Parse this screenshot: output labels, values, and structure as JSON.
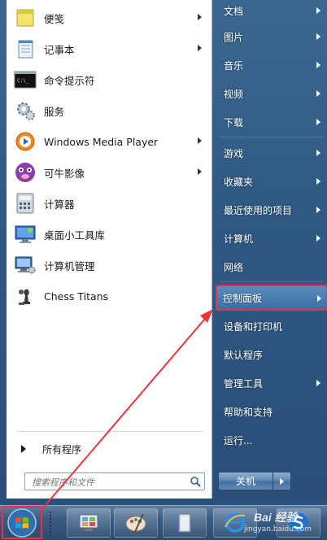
{
  "programs": [
    {
      "label": "便笺",
      "icon": "sticky-notes-icon",
      "has_arrow": true
    },
    {
      "label": "记事本",
      "icon": "notepad-icon",
      "has_arrow": true
    },
    {
      "label": "命令提示符",
      "icon": "command-prompt-icon",
      "has_arrow": false
    },
    {
      "label": "服务",
      "icon": "services-gear-icon",
      "has_arrow": false
    },
    {
      "label": "Windows Media Player",
      "icon": "media-player-icon",
      "has_arrow": true
    },
    {
      "label": "可牛影像",
      "icon": "keniu-image-icon",
      "has_arrow": true
    },
    {
      "label": "计算器",
      "icon": "calculator-icon",
      "has_arrow": false
    },
    {
      "label": "桌面小工具库",
      "icon": "gadgets-icon",
      "has_arrow": false
    },
    {
      "label": "计算机管理",
      "icon": "computer-management-icon",
      "has_arrow": false
    },
    {
      "label": "Chess Titans",
      "icon": "chess-icon",
      "has_arrow": false
    }
  ],
  "all_programs": {
    "label": "所有程序"
  },
  "search": {
    "placeholder": "搜索程序和文件"
  },
  "places": [
    {
      "label": "文档",
      "has_arrow": true
    },
    {
      "label": "图片",
      "has_arrow": true
    },
    {
      "label": "音乐",
      "has_arrow": true
    },
    {
      "label": "视频",
      "has_arrow": true
    },
    {
      "label": "下载",
      "has_arrow": true
    },
    {
      "label": "游戏",
      "has_arrow": true
    },
    {
      "label": "收藏夹",
      "has_arrow": true
    },
    {
      "label": "最近使用的项目",
      "has_arrow": true
    },
    {
      "label": "计算机",
      "has_arrow": true
    },
    {
      "label": "网络",
      "has_arrow": false
    },
    {
      "label": "控制面板",
      "has_arrow": true,
      "highlighted": true
    },
    {
      "label": "设备和打印机",
      "has_arrow": false
    },
    {
      "label": "默认程序",
      "has_arrow": false
    },
    {
      "label": "管理工具",
      "has_arrow": true
    },
    {
      "label": "帮助和支持",
      "has_arrow": false
    },
    {
      "label": "运行...",
      "has_arrow": false
    }
  ],
  "shutdown": {
    "label": "关机"
  },
  "taskbar": {
    "apps": [
      "control-panel-icon",
      "paint-icon",
      "explorer-icon",
      "ie-icon",
      "sogou-icon"
    ]
  },
  "watermark": {
    "text": "Bai 经验",
    "sub": "jingyan.baidu.com"
  },
  "colors": {
    "annotation": "#e8343a",
    "highlight": "#3e6fa3",
    "menu_bg": "#2f5a84"
  }
}
